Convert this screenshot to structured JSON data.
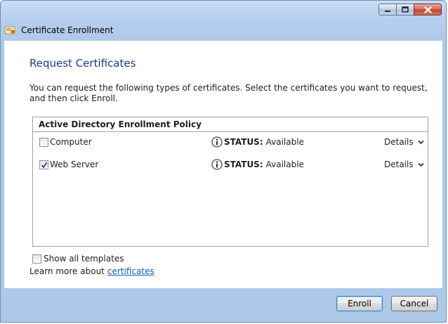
{
  "window": {
    "title": "Certificate Enrollment",
    "controls": {
      "minimize": "minimize-icon",
      "maximize": "maximize-icon",
      "close": "close-icon"
    }
  },
  "main": {
    "heading": "Request Certificates",
    "description": "You can request the following types of certificates. Select the certificates you want to request, and then click Enroll."
  },
  "policy": {
    "header": "Active Directory Enrollment Policy",
    "items": [
      {
        "name": "Computer",
        "checked": false,
        "status_key": "STATUS:",
        "status_value": "Available",
        "details": "Details"
      },
      {
        "name": "Web Server",
        "checked": true,
        "status_key": "STATUS:",
        "status_value": "Available",
        "details": "Details"
      }
    ]
  },
  "options": {
    "show_all_label": "Show all templates",
    "show_all_checked": false,
    "learn_more_prefix": "Learn more about",
    "learn_more_link": "certificates"
  },
  "buttons": {
    "enroll": "Enroll",
    "cancel": "Cancel"
  },
  "colors": {
    "heading": "#1c3a8c",
    "link": "#0b5ab6",
    "titlebar": "#b7cfee"
  }
}
